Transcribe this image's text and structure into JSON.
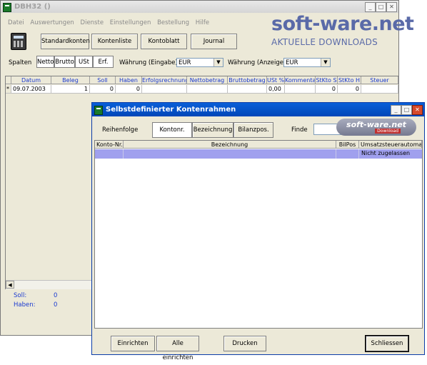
{
  "main": {
    "title": "DBH32 ()",
    "menu": [
      "Datei",
      "Auswertungen",
      "Dienste",
      "Einstellungen",
      "Bestellung",
      "Hilfe"
    ],
    "toolbar": {
      "standardkonten": "Standardkonten",
      "kontenliste": "Kontenliste",
      "kontoblatt": "Kontoblatt",
      "journal": "Journal"
    },
    "spalten_label": "Spalten",
    "column_buttons": [
      "Netto",
      "Brutto",
      "USt",
      "Erf."
    ],
    "waehrung_eingabe_label": "Währung (Eingabe)",
    "waehrung_eingabe_value": "EUR",
    "waehrung_anzeige_label": "Währung (Anzeige)",
    "waehrung_anzeige_value": "EUR",
    "grid": {
      "headers": [
        "Datum",
        "Beleg",
        "Soll",
        "Haben",
        "Erfolgsrechnung",
        "Nettobetrag",
        "Bruttobetrag",
        "USt %",
        "Kommentar",
        "StKto S",
        "StKto H",
        "Steuer"
      ],
      "row": {
        "marker": "*",
        "datum": "09.07.2003",
        "beleg": "1",
        "soll": "0",
        "haben": "0",
        "ust": "0,00",
        "stkto_s": "0",
        "stkto_h": "0"
      }
    },
    "summary": {
      "soll_label": "Soll:",
      "soll_value": "0",
      "haben_label": "Haben:",
      "haben_value": "0"
    }
  },
  "watermark": {
    "logo": "soft-ware.net",
    "tagline": "AKTUELLE DOWNLOADS"
  },
  "dialog": {
    "title": "Selbstdefinierter Kontenrahmen",
    "reihenfolge_label": "Reihenfolge",
    "order_buttons": [
      "Kontonr.",
      "Bezeichnung",
      "Bilanzpos."
    ],
    "finde_label": "Finde",
    "finde_value": "",
    "badge_logo": "soft-ware.net",
    "badge_sub": "Download",
    "headers": [
      "Konto-Nr.",
      "Bezeichnung",
      "BilPos",
      "Umsatzsteuerautomatik"
    ],
    "row": {
      "konto_nr": "",
      "bezeichnung": "",
      "bilpos": "",
      "umsatzsteuer": "Nicht zugelassen"
    },
    "footer": {
      "einrichten": "Einrichten",
      "alle_einrichten": "Alle einrichten",
      "drucken": "Drucken",
      "schliessen": "Schliessen"
    }
  }
}
